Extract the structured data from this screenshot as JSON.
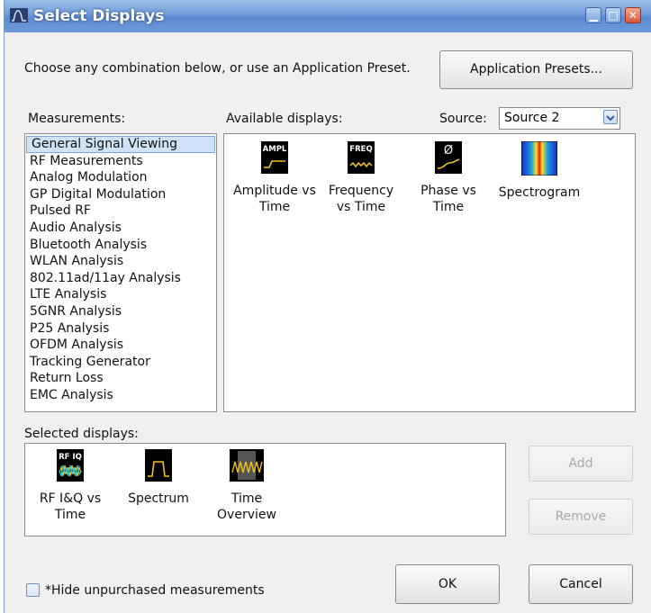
{
  "window": {
    "title": "Select Displays"
  },
  "header": {
    "instruction": "Choose any combination below, or use an Application Preset.",
    "presets_button": "Application Presets..."
  },
  "measurements": {
    "label": "Measurements:",
    "items": [
      "General Signal Viewing",
      "RF Measurements",
      "Analog Modulation",
      "GP Digital Modulation",
      "Pulsed RF",
      "Audio Analysis",
      "Bluetooth Analysis",
      "WLAN Analysis",
      "802.11ad/11ay Analysis",
      "LTE Analysis",
      "5GNR Analysis",
      "P25 Analysis",
      "OFDM Analysis",
      "Tracking Generator",
      "Return Loss",
      "EMC Analysis"
    ],
    "selected": "General Signal Viewing"
  },
  "available": {
    "label": "Available displays:",
    "source_label": "Source:",
    "source_value": "Source 2",
    "items": [
      {
        "icon": "amplitude-vs-time-icon",
        "icon_text": "AMPL",
        "line1": "Amplitude vs",
        "line2": "Time"
      },
      {
        "icon": "frequency-vs-time-icon",
        "icon_text": "FREQ",
        "line1": "Frequency",
        "line2": "vs Time"
      },
      {
        "icon": "phase-vs-time-icon",
        "icon_text": "Ø",
        "line1": "Phase vs",
        "line2": "Time"
      },
      {
        "icon": "spectrogram-icon",
        "icon_text": "",
        "line1": "Spectrogram",
        "line2": ""
      }
    ]
  },
  "selected_displays": {
    "label": "Selected displays:",
    "items": [
      {
        "icon": "rf-iq-vs-time-icon",
        "icon_text": "RF IQ",
        "line1": "RF I&Q vs",
        "line2": "Time"
      },
      {
        "icon": "spectrum-icon",
        "icon_text": "",
        "line1": "Spectrum",
        "line2": ""
      },
      {
        "icon": "time-overview-icon",
        "icon_text": "",
        "line1": "Time",
        "line2": "Overview"
      }
    ]
  },
  "buttons": {
    "add": "Add",
    "remove": "Remove",
    "ok": "OK",
    "cancel": "Cancel"
  },
  "footer": {
    "hide_checkbox_label": "*Hide unpurchased measurements",
    "hide_checked": false
  },
  "colors": {
    "titlebar": "#6f9bd9",
    "icon_bg": "#000000",
    "icon_trace": "#f2c318",
    "selection": "#cfe3f7"
  }
}
